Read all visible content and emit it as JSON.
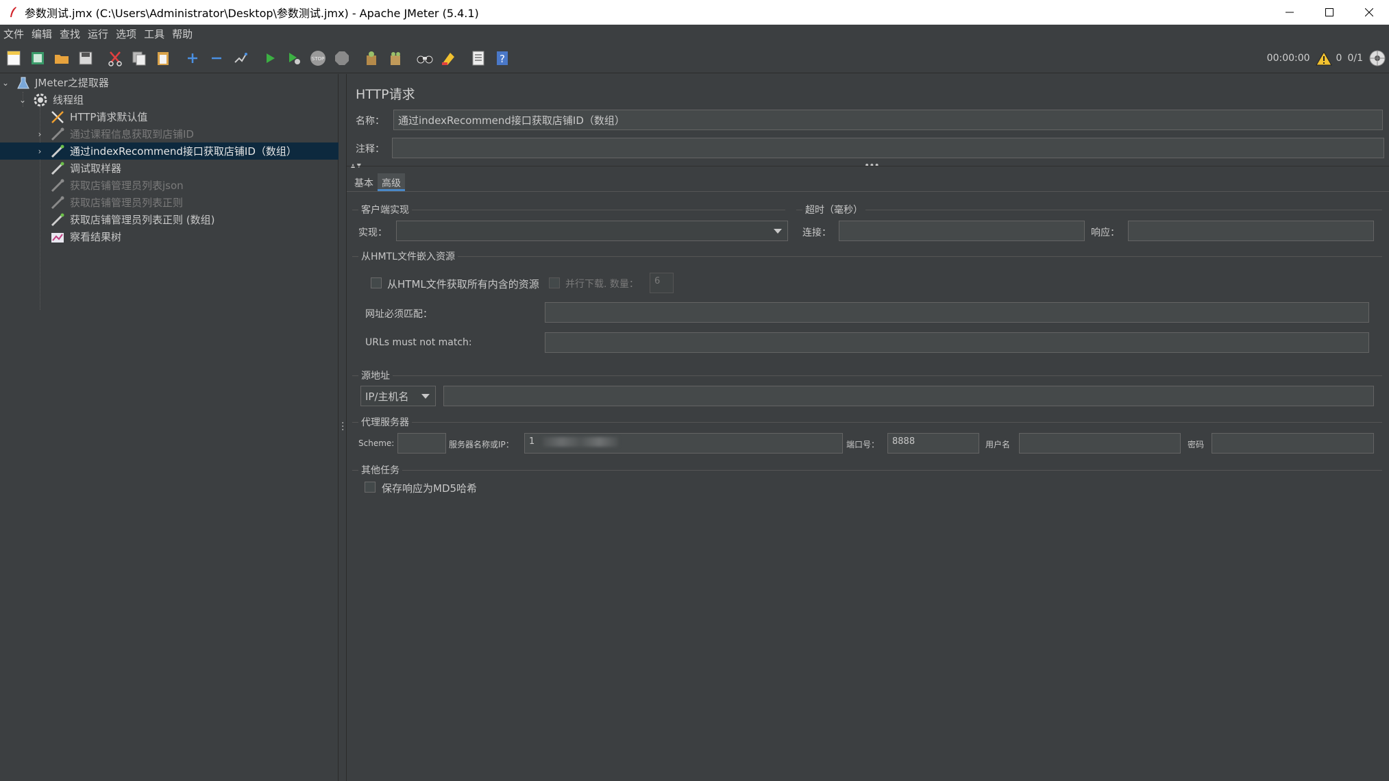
{
  "window": {
    "title": "参数测试.jmx (C:\\Users\\Administrator\\Desktop\\参数测试.jmx) - Apache JMeter (5.4.1)",
    "controls": [
      "—",
      "☐",
      "✕"
    ]
  },
  "menu": [
    "文件",
    "编辑",
    "查找",
    "运行",
    "选项",
    "工具",
    "帮助"
  ],
  "toolbar": {
    "timer": "00:00:00",
    "warnings": "0",
    "threads": "0/1"
  },
  "tree": {
    "items": [
      {
        "label": "JMeter之提取器",
        "icon": "flask-icon",
        "disabled": false
      },
      {
        "label": "线程组",
        "icon": "gear-icon",
        "disabled": false
      },
      {
        "label": "HTTP请求默认值",
        "icon": "tools-icon",
        "disabled": false
      },
      {
        "label": "通过课程信息获取到店铺ID",
        "icon": "pipette-icon",
        "disabled": true
      },
      {
        "label": "通过indexRecommend接口获取店铺ID（数组）",
        "icon": "pipette-icon",
        "disabled": false
      },
      {
        "label": "调试取样器",
        "icon": "pipette-icon",
        "disabled": false
      },
      {
        "label": "获取店铺管理员列表json",
        "icon": "pipette-icon",
        "disabled": true
      },
      {
        "label": "获取店铺管理员列表正则",
        "icon": "pipette-icon",
        "disabled": true
      },
      {
        "label": "获取店铺管理员列表正则 (数组)",
        "icon": "pipette-icon",
        "disabled": false
      },
      {
        "label": "察看结果树",
        "icon": "chart-icon",
        "disabled": false
      }
    ]
  },
  "panel": {
    "title": "HTTP请求",
    "name_label": "名称：",
    "name_value": "通过indexRecommend接口获取店铺ID（数组）",
    "comment_label": "注释：",
    "comment_value": "",
    "tabs": [
      "基本",
      "高级"
    ],
    "active_tab": "高级",
    "client_impl": {
      "section": "客户端实现",
      "impl_label": "实现：",
      "impl_value": ""
    },
    "timeout": {
      "section": "超时（毫秒）",
      "connect_label": "连接：",
      "connect_value": "",
      "response_label": "响应：",
      "response_value": ""
    },
    "embedded": {
      "section": "从HMTL文件嵌入资源",
      "retrieve_label": "从HTML文件获取所有内含的资源",
      "parallel_label": "并行下载. 数量：",
      "parallel_value": "6",
      "must_match_label": "网址必须匹配：",
      "must_match_value": "",
      "must_not_match_label": "URLs must not match:",
      "must_not_match_value": ""
    },
    "source": {
      "section": "源地址",
      "type_value": "IP/主机名",
      "address_value": ""
    },
    "proxy": {
      "section": "代理服务器",
      "scheme_label": "Scheme:",
      "scheme_value": "",
      "server_label": "服务器名称或IP：",
      "server_value": "1",
      "port_label": "端口号：",
      "port_value": "8888",
      "user_label": "用户名",
      "user_value": "",
      "password_label": "密码",
      "password_value": ""
    },
    "other": {
      "section": "其他任务",
      "md5_label": "保存响应为MD5哈希"
    }
  },
  "colors": {
    "background": "#3c3f41",
    "selection": "#0d293e",
    "field": "#45494a",
    "tab_accent": "#4a88c7",
    "disabled_text": "#7a7a7a",
    "text": "#c8c8c8"
  }
}
